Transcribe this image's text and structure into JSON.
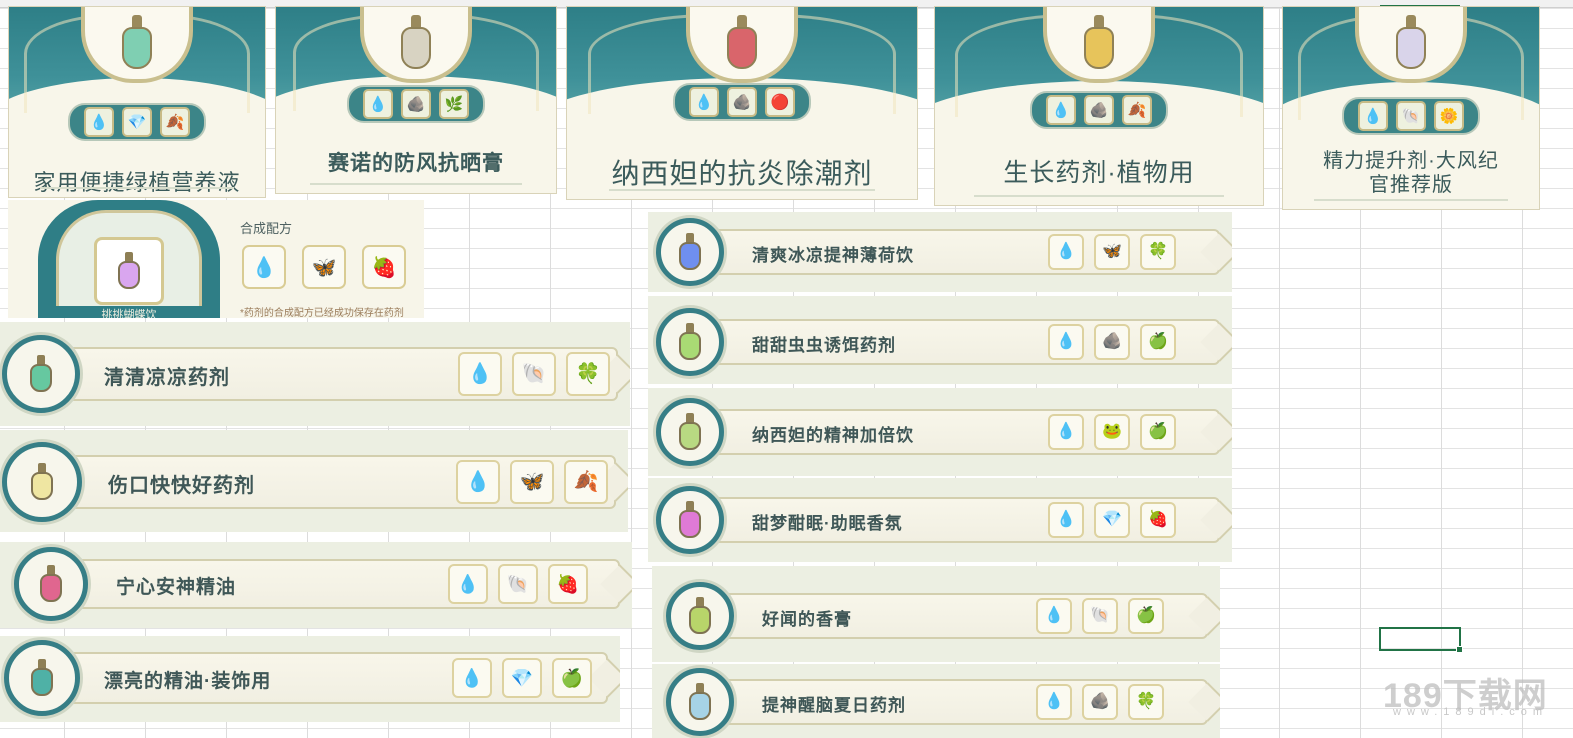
{
  "colors": {
    "teal": "#2f7e86",
    "cream": "#f8f6ea",
    "gold": "#d4c891",
    "text": "#3f5757"
  },
  "cards": [
    {
      "title": "家用便捷绿植营养液",
      "ingredients": [
        "💧",
        "💎",
        "🍂"
      ],
      "bottle_color": "#7fcfb2"
    },
    {
      "title": "赛诺的防风抗晒膏",
      "ingredients": [
        "💧",
        "🪨",
        "🌿"
      ],
      "bottle_color": "#d8d3c2"
    },
    {
      "title": "纳西妲的抗炎除潮剂",
      "ingredients": [
        "💧",
        "🪨",
        "🔴"
      ],
      "bottle_color": "#d9656b"
    },
    {
      "title": "生长药剂·植物用",
      "ingredients": [
        "💧",
        "🪨",
        "🍂"
      ],
      "bottle_color": "#e7c45b"
    },
    {
      "title": "精力提升剂·大风纪官推荐版",
      "ingredients": [
        "💧",
        "🐚",
        "🌼"
      ],
      "bottle_color": "#d9d4ea"
    }
  ],
  "synthesis": {
    "label": "合成配方",
    "item_name": "挑挑蝴蝶饮",
    "ingredients": [
      "💧",
      "🦋",
      "🍓"
    ],
    "note": "*药剂的合成配方已经成功保存在药剂"
  },
  "left_rows": [
    {
      "name": "清清凉凉药剂",
      "ingredients": [
        "💧",
        "🐚",
        "🍀"
      ],
      "bottle_color": "#66c8a0"
    },
    {
      "name": "伤口快快好药剂",
      "ingredients": [
        "💧",
        "🦋",
        "🍂"
      ],
      "bottle_color": "#efe6a2"
    },
    {
      "name": "宁心安神精油",
      "ingredients": [
        "💧",
        "🐚",
        "🍓"
      ],
      "bottle_color": "#e0668f"
    },
    {
      "name": "漂亮的精油·装饰用",
      "ingredients": [
        "💧",
        "💎",
        "🍏"
      ],
      "bottle_color": "#4fb1a6"
    }
  ],
  "right_rows": [
    {
      "name": "清爽冰凉提神薄荷饮",
      "ingredients": [
        "💧",
        "🦋",
        "🍀"
      ],
      "bottle_color": "#6f8ff0"
    },
    {
      "name": "甜甜虫虫诱饵药剂",
      "ingredients": [
        "💧",
        "🪨",
        "🍏"
      ],
      "bottle_color": "#a9da74"
    },
    {
      "name": "纳西妲的精神加倍饮",
      "ingredients": [
        "💧",
        "🐸",
        "🍏"
      ],
      "bottle_color": "#b8d982"
    },
    {
      "name": "甜梦酣眠·助眠香氛",
      "ingredients": [
        "💧",
        "💎",
        "🍓"
      ],
      "bottle_color": "#df7ad6"
    },
    {
      "name": "好闻的香膏",
      "ingredients": [
        "💧",
        "🐚",
        "🍏"
      ],
      "bottle_color": "#b8d56a"
    },
    {
      "name": "提神醒脑夏日药剂",
      "ingredients": [
        "💧",
        "🪨",
        "🍀"
      ],
      "bottle_color": "#a6d3e6"
    }
  ],
  "watermark": {
    "main": "189下载网",
    "sub": "www.189dl.com"
  }
}
